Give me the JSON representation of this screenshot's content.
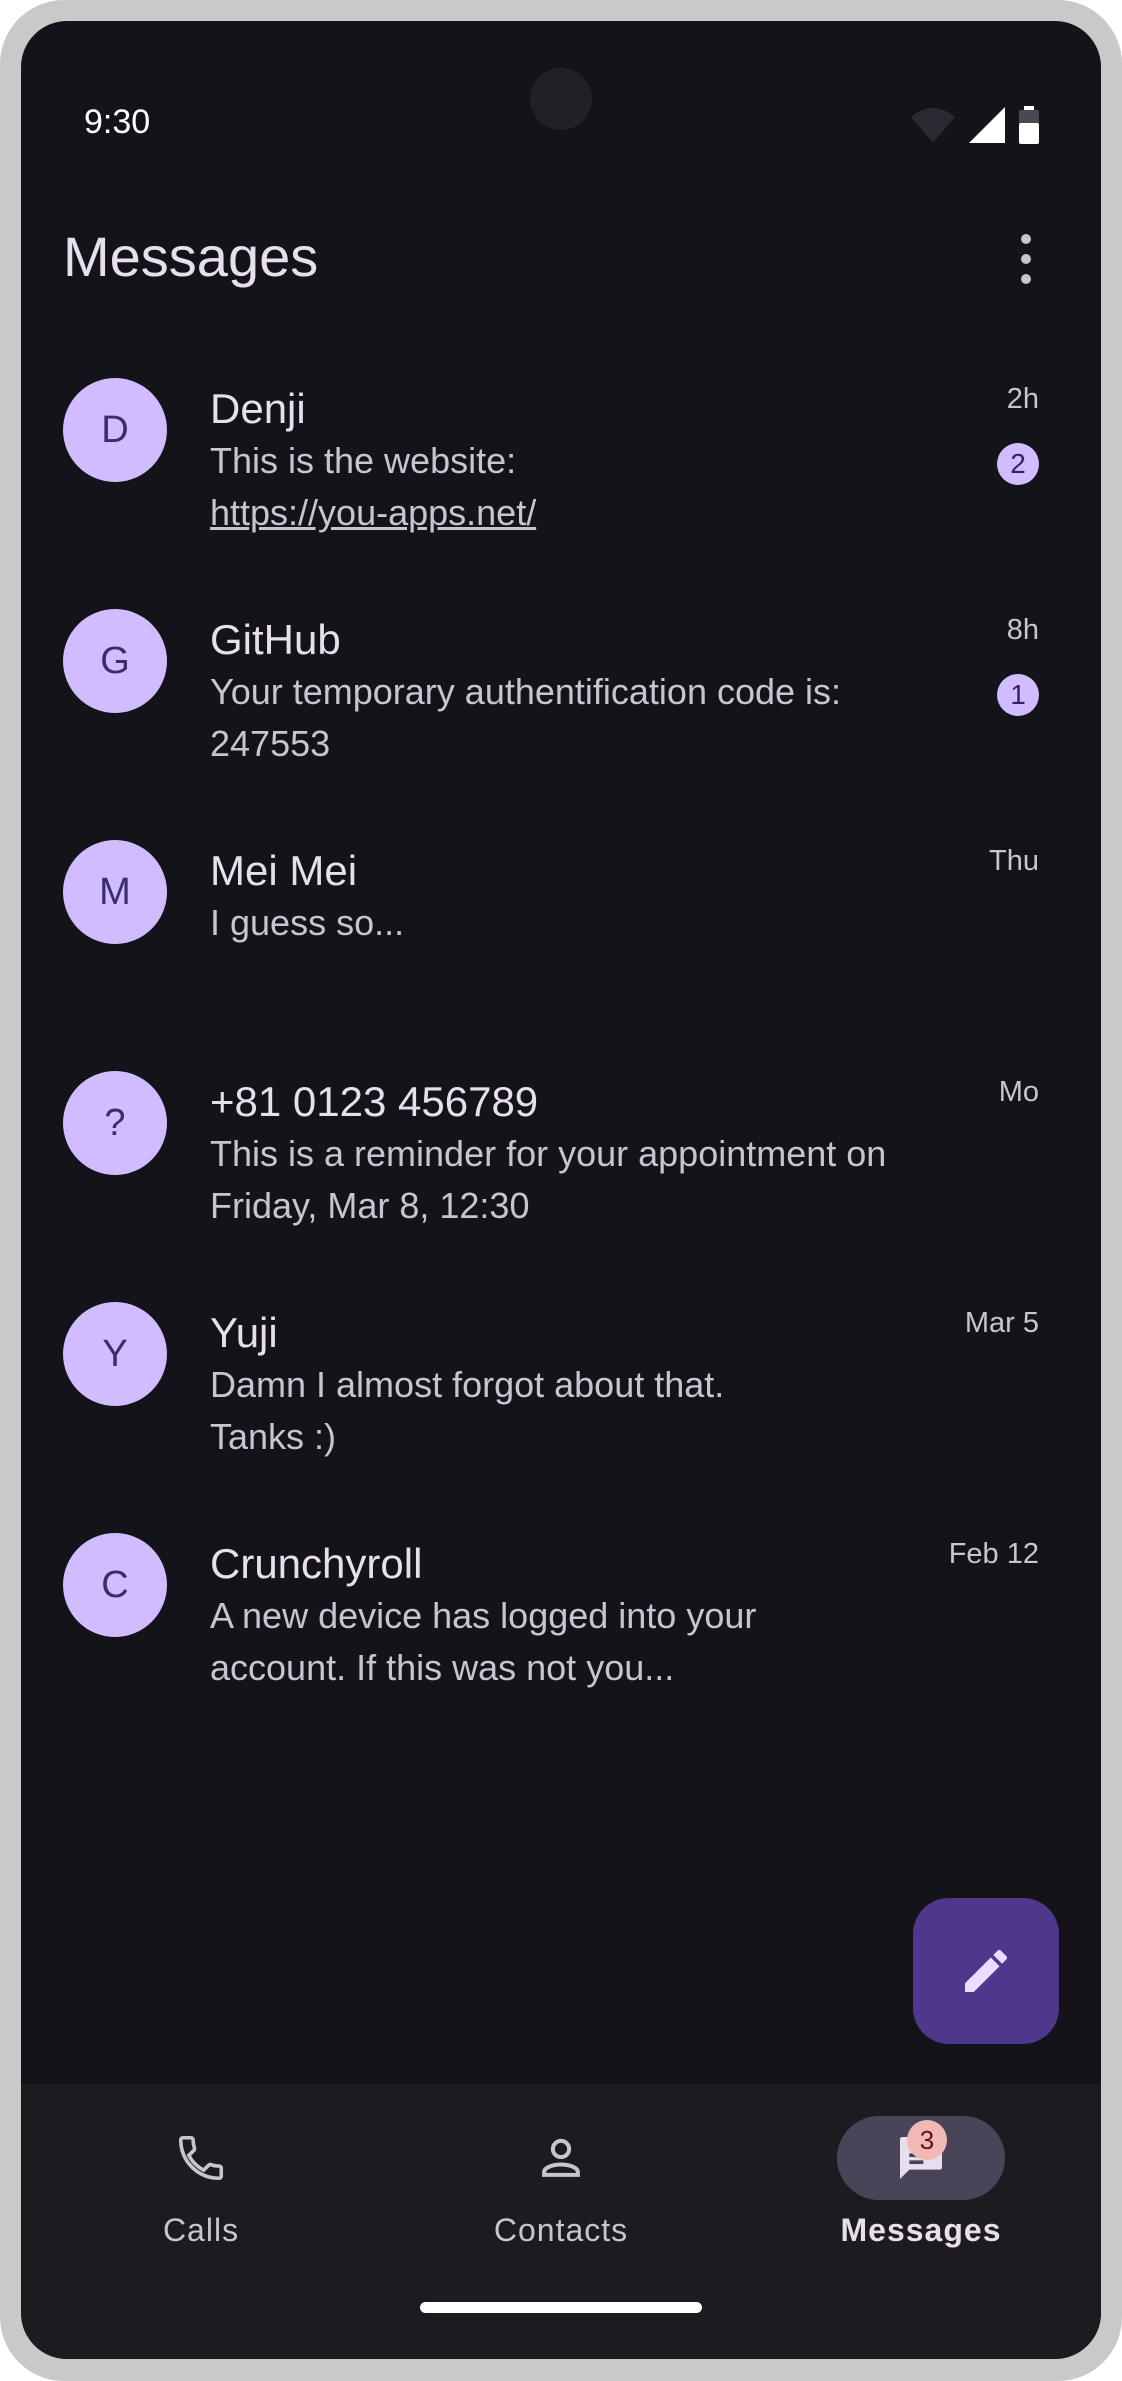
{
  "status_bar": {
    "time": "9:30",
    "icons": [
      "wifi-icon",
      "signal-icon",
      "battery-icon"
    ]
  },
  "header": {
    "title": "Messages",
    "menu_icon": "more-vert-icon"
  },
  "conversations": [
    {
      "initial": "D",
      "name": "Denji",
      "preview": "This is the website:",
      "preview_link": "https://you-apps.net/",
      "time": "2h",
      "unread": "2"
    },
    {
      "initial": "G",
      "name": "GitHub",
      "preview": "Your temporary authentification code is: 247553",
      "time": "8h",
      "unread": "1"
    },
    {
      "initial": "M",
      "name": "Mei Mei",
      "preview": "I guess so...",
      "time": "Thu",
      "unread": ""
    },
    {
      "initial": "?",
      "name": "+81 0123 456789",
      "preview": "This is a reminder for your appointment on Friday, Mar 8, 12:30",
      "time": "Mo",
      "unread": ""
    },
    {
      "initial": "Y",
      "name": "Yuji",
      "preview": "Damn I almost forgot about that. Tanks :)",
      "time": "Mar 5",
      "unread": ""
    },
    {
      "initial": "C",
      "name": "Crunchyroll",
      "preview": "A new device has logged into your account. If this was not you...",
      "time": "Feb 12",
      "unread": ""
    }
  ],
  "fab": {
    "icon": "edit-icon"
  },
  "nav": {
    "items": [
      {
        "label": "Calls",
        "icon": "phone-icon",
        "active": false
      },
      {
        "label": "Contacts",
        "icon": "person-icon",
        "active": false
      },
      {
        "label": "Messages",
        "icon": "message-icon",
        "active": true,
        "badge": "3"
      }
    ]
  },
  "colors": {
    "background": "#15131a",
    "avatar": "#d0bcff",
    "fab": "#4f378b",
    "nav_active": "#4a4458",
    "badge_error": "#f2b8b5"
  }
}
